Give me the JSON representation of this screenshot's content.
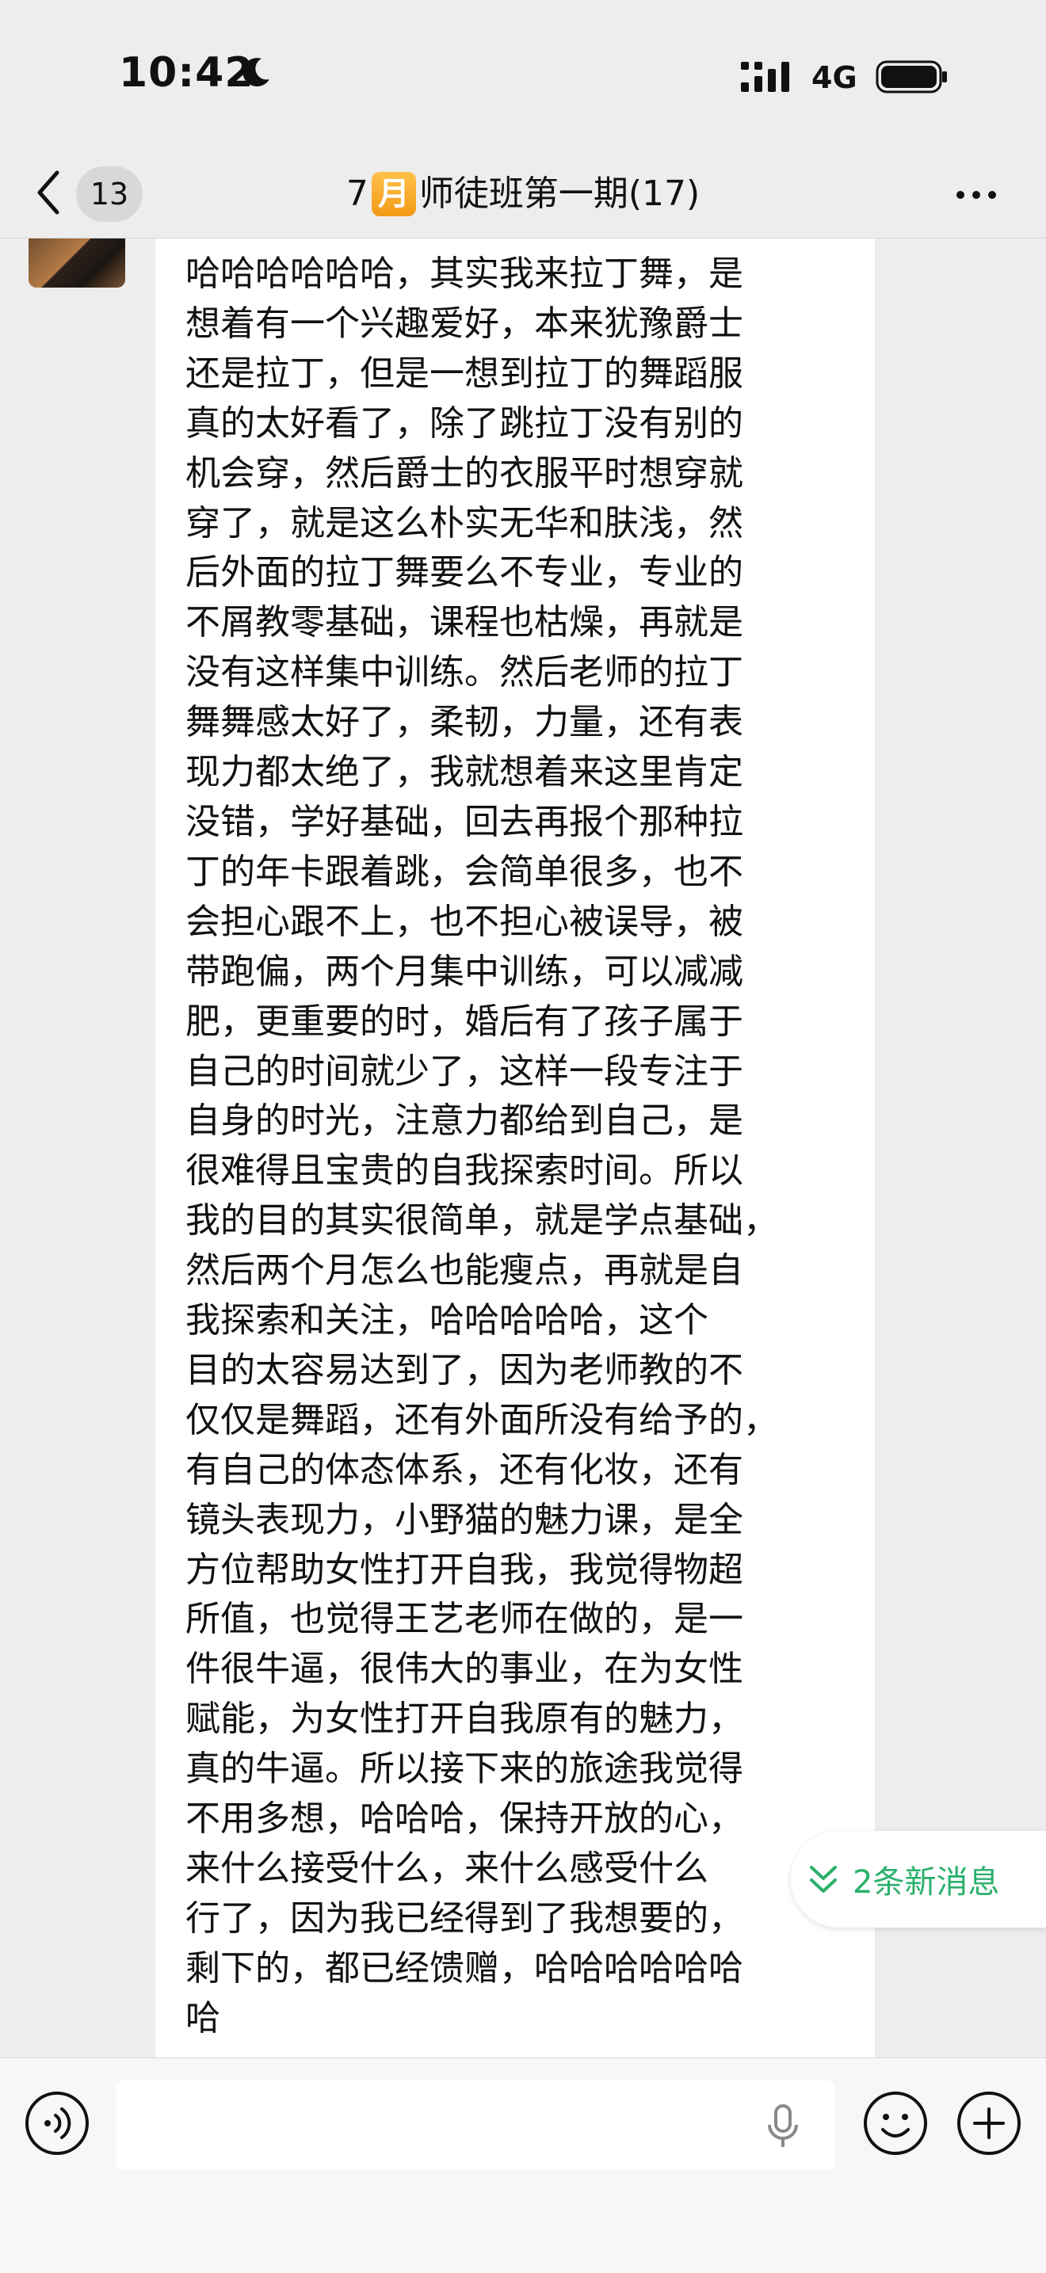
{
  "status_bar": {
    "time": "10:42",
    "network": "4G",
    "icons": [
      "moon-icon",
      "signal-icon",
      "battery-icon"
    ]
  },
  "nav": {
    "unread_count": "13",
    "title_prefix": "7",
    "title_badge": "月",
    "title_suffix": "师徒班第一期(17)",
    "icons": [
      "back-icon",
      "more-icon"
    ]
  },
  "chat": {
    "message_text": "哈哈哈哈哈哈，其实我来拉丁舞，是\n想着有一个兴趣爱好，本来犹豫爵士\n还是拉丁，但是一想到拉丁的舞蹈服\n真的太好看了，除了跳拉丁没有别的\n机会穿，然后爵士的衣服平时想穿就\n穿了，就是这么朴实无华和肤浅，然\n后外面的拉丁舞要么不专业，专业的\n不屑教零基础，课程也枯燥，再就是\n没有这样集中训练。然后老师的拉丁\n舞舞感太好了，柔韧，力量，还有表\n现力都太绝了，我就想着来这里肯定\n没错，学好基础，回去再报个那种拉\n丁的年卡跟着跳，会简单很多，也不\n会担心跟不上，也不担心被误导，被\n带跑偏，两个月集中训练，可以减减\n肥，更重要的时，婚后有了孩子属于\n自己的时间就少了，这样一段专注于\n自身的时光，注意力都给到自己，是\n很难得且宝贵的自我探索时间。所以\n我的目的其实很简单，就是学点基础，\n然后两个月怎么也能瘦点，再就是自\n我探索和关注，哈哈哈哈哈，这个\n目的太容易达到了，因为老师教的不\n仅仅是舞蹈，还有外面所没有给予的，\n有自己的体态体系，还有化妆，还有\n镜头表现力，小野猫的魅力课，是全\n方位帮助女性打开自我，我觉得物超\n所值，也觉得王艺老师在做的，是一\n件很牛逼，很伟大的事业，在为女性\n赋能，为女性打开自我原有的魅力，\n真的牛逼。所以接下来的旅途我觉得\n不用多想，哈哈哈，保持开放的心，\n来什么接受什么，来什么感受什么\n行了，因为我已经得到了我想要的，\n剩下的，都已经馈赠，哈哈哈哈哈哈\n哈",
    "new_messages_label": "2条新消息"
  },
  "input_bar": {
    "text_value": "",
    "icons": [
      "voice-icon",
      "mic-icon",
      "emoji-icon",
      "plus-icon"
    ]
  },
  "colors": {
    "background": "#ededed",
    "bubble": "#ffffff",
    "accent_green": "#2ab06b",
    "badge_orange": "#f29a16"
  }
}
